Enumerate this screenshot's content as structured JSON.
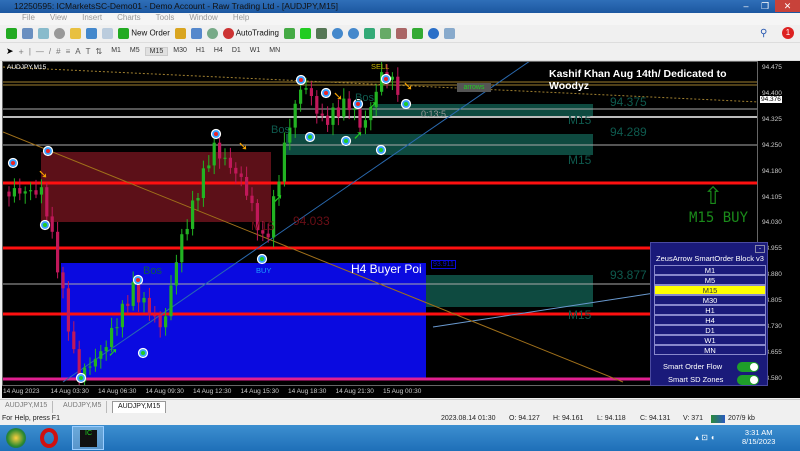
{
  "window": {
    "title": "12250595: ICMarketsSC-Demo01 - Demo Account - Raw Trading Ltd - [AUDJPY,M15]"
  },
  "menu": [
    "File",
    "View",
    "Insert",
    "Charts",
    "Tools",
    "Window",
    "Help"
  ],
  "toolbar": {
    "new_order": "New Order",
    "autotrading": "AutoTrading",
    "timeframes": [
      "M1",
      "M5",
      "M15",
      "M30",
      "H1",
      "H4",
      "D1",
      "W1",
      "MN"
    ],
    "selected_tf": "M15",
    "notifications": "1"
  },
  "chart": {
    "symbol_label": "AUDJPY,M15",
    "headline": "Kashif Khan Aug 14th/ Dedicated to Woodyz",
    "sell_label": "SELL",
    "buy_label": "BUY",
    "arrows_button": "arrows",
    "countdown": "0:13:5",
    "zone_labels": {
      "z1_price": "94.375",
      "z1_tf": "M15",
      "z2_price": "94.289",
      "z2_tf": "M15",
      "red_price": "94.033",
      "red_tf": "M15",
      "blue_price": "93.877",
      "blue_tf": "M15",
      "blue_title": "H4 Buyer Poi",
      "blue_tag": "93.911"
    },
    "bos": [
      "Bos",
      "Bos",
      "Bos"
    ],
    "signal": "M15 BUY",
    "current_price": "94.376",
    "price_ticks": [
      "94.475",
      "94.400",
      "94.325",
      "94.250",
      "94.180",
      "94.105",
      "94.030",
      "93.955",
      "93.880",
      "93.805",
      "93.730",
      "93.655",
      "93.580"
    ],
    "time_ticks": [
      "14 Aug 2023",
      "14 Aug 03:30",
      "14 Aug 06:30",
      "14 Aug 09:30",
      "14 Aug 12:30",
      "14 Aug 15:30",
      "14 Aug 18:30",
      "14 Aug 21:30",
      "15 Aug 00:30"
    ],
    "colors": {
      "supply": "#5c1018",
      "demand": "#0a0ae0",
      "zone_teal": "#0e4a40",
      "level_red": "#ff1010",
      "bull": "#22b322",
      "bear": "#c0185a"
    }
  },
  "panel": {
    "title": "ZeusArrow SmartOrder Block v3",
    "timeframes": [
      "M1",
      "M5",
      "M15",
      "M30",
      "H1",
      "H4",
      "D1",
      "W1",
      "MN"
    ],
    "selected": "M15",
    "toggles": [
      {
        "label": "Smart Order Flow",
        "on": true
      },
      {
        "label": "Smart SD Zones",
        "on": true
      }
    ]
  },
  "tabs": [
    "AUDJPY,M15",
    "AUDJPY,M5",
    "AUDJPY,M15"
  ],
  "active_tab": 2,
  "status": {
    "help": "For Help, press F1",
    "datetime": "2023.08.14 01:30",
    "open": "O: 94.127",
    "high": "H: 94.161",
    "low": "L: 94.118",
    "close": "C: 94.131",
    "volume": "V: 371",
    "traffic": "207/9 kb"
  },
  "taskbar": {
    "time": "3:31 AM",
    "date": "8/15/2023"
  }
}
